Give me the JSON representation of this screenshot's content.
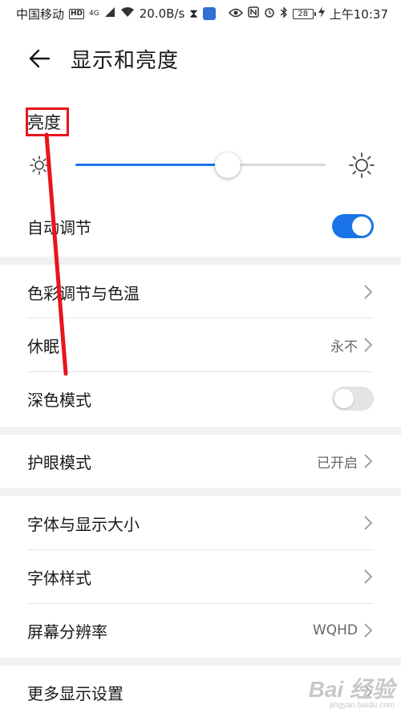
{
  "status_bar": {
    "carrier": "中国移动",
    "hd_badge": "HD",
    "network_type": "4G",
    "speed": "20.0B/s",
    "battery": "28",
    "time": "上午10:37"
  },
  "header": {
    "title": "显示和亮度"
  },
  "brightness": {
    "label": "亮度",
    "level": 0.61,
    "accent_color": "#1a73e8"
  },
  "auto_adjust": {
    "label": "自动调节",
    "enabled": true
  },
  "rows": {
    "color_temp": {
      "label": "色彩调节与色温",
      "value": ""
    },
    "sleep": {
      "label": "休眠",
      "value": "永不"
    },
    "dark_mode": {
      "label": "深色模式",
      "enabled": false
    },
    "eye_comfort": {
      "label": "护眼模式",
      "value": "已开启"
    },
    "font_size": {
      "label": "字体与显示大小",
      "value": ""
    },
    "font_style": {
      "label": "字体样式",
      "value": ""
    },
    "resolution": {
      "label": "屏幕分辨率",
      "value": "WQHD"
    },
    "more_settings": {
      "label": "更多显示设置",
      "value": ""
    }
  },
  "annotation_color": "#e8141e",
  "watermark": {
    "logo": "Bai 经验",
    "site": "jingyan.baidu.com"
  }
}
